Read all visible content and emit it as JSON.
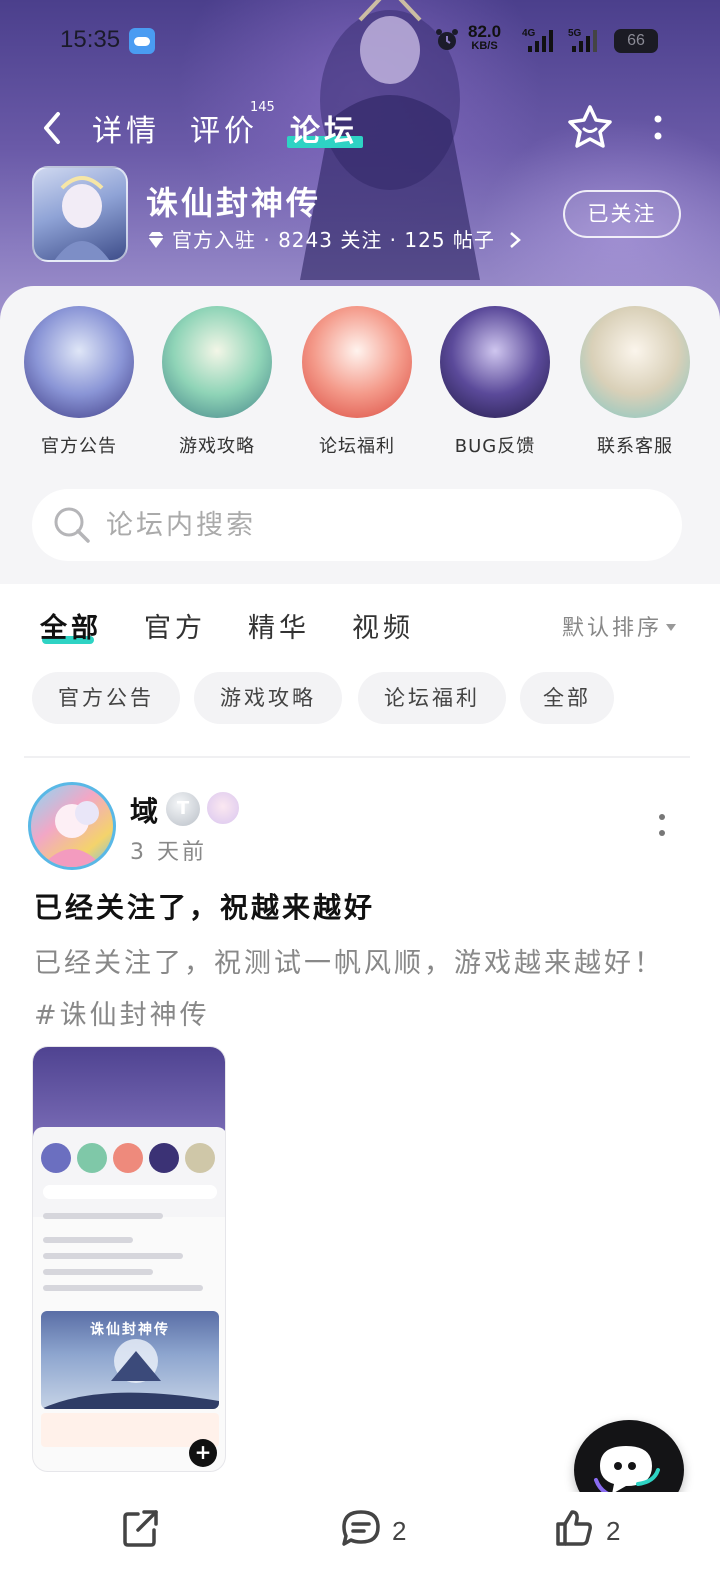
{
  "status_bar": {
    "time": "15:35",
    "speed_value": "82.0",
    "speed_unit": "KB/S",
    "net1": "4G",
    "net2": "5G",
    "battery": "66"
  },
  "nav": {
    "tabs": [
      {
        "label": "详情"
      },
      {
        "label": "评价",
        "badge": "145"
      },
      {
        "label": "论坛"
      }
    ],
    "active_tab": "论坛"
  },
  "game": {
    "name": "诛仙封神传",
    "meta": "官方入驻 · 8243 关注 · 125 帖子",
    "follow_label": "已关注"
  },
  "categories": [
    {
      "label": "官方公告"
    },
    {
      "label": "游戏攻略"
    },
    {
      "label": "论坛福利"
    },
    {
      "label": "BUG反馈"
    },
    {
      "label": "联系客服"
    }
  ],
  "search": {
    "placeholder": "论坛内搜索"
  },
  "feed": {
    "tabs": [
      "全部",
      "官方",
      "精华",
      "视频"
    ],
    "active_tab": "全部",
    "sort_label": "默认排序",
    "chips": [
      "官方公告",
      "游戏攻略",
      "论坛福利",
      "全部"
    ]
  },
  "post": {
    "author": "域",
    "level": "T",
    "time": "3 天前",
    "title": "已经关注了，祝越来越好",
    "body": "已经关注了，祝测试一帆风顺，游戏越来越好！#诛仙封神传"
  },
  "actions": {
    "comments": "2",
    "likes": "2"
  },
  "colors": {
    "accent": "#2ed3c4",
    "header_bg": "#5b4c9f"
  }
}
